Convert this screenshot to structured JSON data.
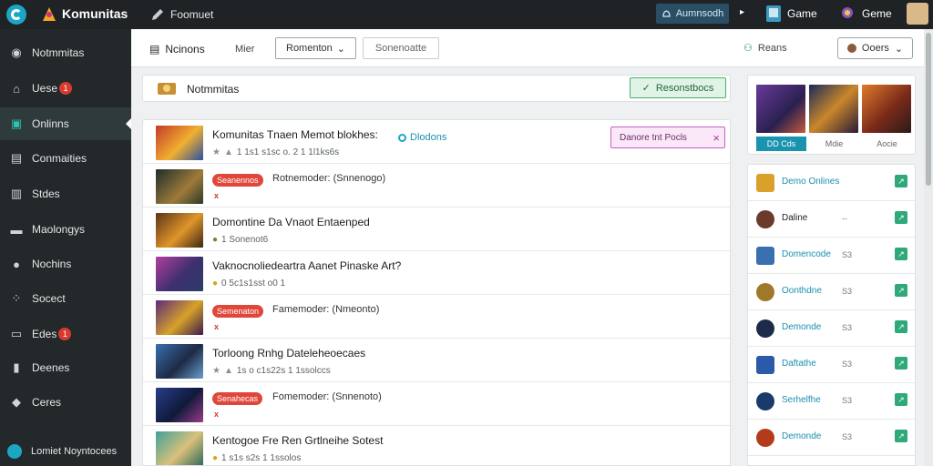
{
  "topbar": {
    "brand": "Komunitas",
    "post_label": "Foomuet",
    "notify_button": "Aumnsodh",
    "game1_label": "Game",
    "game2_label": "Geme"
  },
  "sidebar": {
    "items": [
      {
        "label": "Notmmitas",
        "icon": "gauge-icon",
        "badge": ""
      },
      {
        "label": "Uese",
        "icon": "home-icon",
        "badge": "1"
      },
      {
        "label": "Onlinns",
        "icon": "gamepad-icon",
        "badge": "",
        "active": true
      },
      {
        "label": "Conmaities",
        "icon": "community-icon",
        "badge": ""
      },
      {
        "label": "Stdes",
        "icon": "bars-icon",
        "badge": ""
      },
      {
        "label": "Maolongys",
        "icon": "folder-icon",
        "badge": ""
      },
      {
        "label": "Nochins",
        "icon": "user-icon",
        "badge": ""
      },
      {
        "label": "Socect",
        "icon": "grid-icon",
        "badge": ""
      },
      {
        "label": "Edes",
        "icon": "card-icon",
        "badge": "1"
      },
      {
        "label": "Deenes",
        "icon": "stats-icon",
        "badge": ""
      },
      {
        "label": "Ceres",
        "icon": "diamond-icon",
        "badge": ""
      }
    ],
    "footer": "Lomiet Noyntocees"
  },
  "toolbar": {
    "title": "Ncinons",
    "filter_label": "Mier",
    "select1": "Romenton",
    "select2": "Sonenoatte",
    "users_label": "Reans",
    "game_select": "Ooers"
  },
  "feed_header": {
    "title": "Notmmitas",
    "button": "Resonstbocs"
  },
  "feed": [
    {
      "type": "post",
      "title": "Komunitas Tnaen Memot blokhes:",
      "online": "Dlodons",
      "meta": "1 1s1 s1sc o. 2  1 1l1ks6s",
      "pill": "Danore tnt Pocls"
    },
    {
      "type": "tag",
      "tag": "Seanennos",
      "tag_text": "Rotnemoder: (Snnenogo)",
      "mark": "x"
    },
    {
      "type": "post",
      "title": "Domontine Da Vnaot Entaenped",
      "meta": "1 Sonenot6"
    },
    {
      "type": "post",
      "title": "Vaknocnoliedeartra Aanet Pinaske Art?",
      "meta": "0 5c1s1sst o0 1"
    },
    {
      "type": "tag",
      "tag": "Semenaton",
      "tag_text": "Famemoder: (Nmeonto)",
      "mark": "x"
    },
    {
      "type": "post",
      "title": "Torloong Rnhg Dateleheoecaes",
      "meta": "1s o c1s22s  1 1ssolccs"
    },
    {
      "type": "tag",
      "tag": "Senahecas",
      "tag_text": "Fomemoder: (Snnenoto)",
      "mark": "x"
    },
    {
      "type": "post",
      "title": "Kentogoe Fre Ren Grtlneihe Sotest",
      "meta": "1 s1s s2s  1 1ssolos"
    }
  ],
  "right_panel": {
    "tabs": [
      "DD Cds",
      "Mdie",
      "Aocie"
    ],
    "list": [
      {
        "name": "Demo Onlines",
        "count": "",
        "dark": false
      },
      {
        "name": "Daline",
        "count": "--",
        "dark": true
      },
      {
        "name": "Domencode",
        "count": "S3",
        "dark": false
      },
      {
        "name": "Oonthdne",
        "count": "S3",
        "dark": false
      },
      {
        "name": "Demonde",
        "count": "S3",
        "dark": false
      },
      {
        "name": "Daftathe",
        "count": "S3",
        "dark": false
      },
      {
        "name": "Serhelfhe",
        "count": "S3",
        "dark": false
      },
      {
        "name": "Demonde",
        "count": "S3",
        "dark": false
      }
    ]
  },
  "colors": {
    "accent": "#1ca6c6",
    "sidebar_bg": "#23282b",
    "topbar_bg": "#1f2326",
    "tag_red": "#e0473a",
    "green": "#2fa87a"
  }
}
